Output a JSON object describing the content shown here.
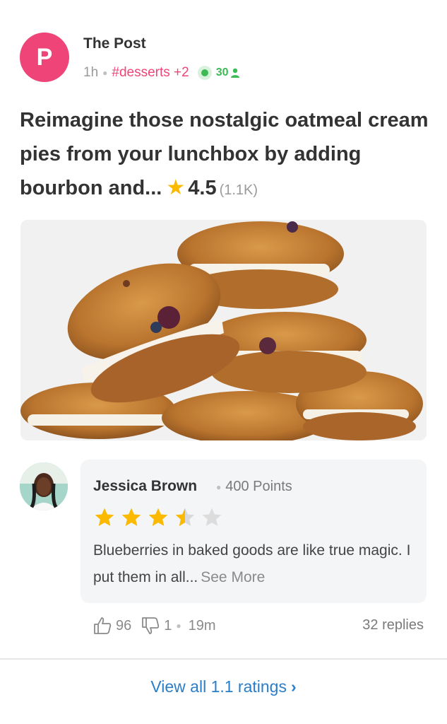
{
  "post": {
    "avatar_letter": "P",
    "author": "The Post",
    "time": "1h",
    "tag": "#desserts +2",
    "online_count": "30",
    "title": "Reimagine those nostalgic oatmeal cream pies from your lunchbox by adding bourbon and...",
    "rating": "4.5",
    "rating_count": "(1.1K)"
  },
  "review": {
    "name": "Jessica Brown",
    "points": "400 Points",
    "stars": 3.5,
    "text": "Blueberries in baked goods are like true magic. I put them in all...",
    "see_more": "See More",
    "likes": "96",
    "dislikes": "1",
    "time": "19m",
    "replies": "32 replies"
  },
  "footer": {
    "view_all": "View all 1.1 ratings"
  },
  "colors": {
    "brand_pink": "#ef4477",
    "star": "#fbb900",
    "online": "#3cba54",
    "link": "#2a7ec9"
  }
}
